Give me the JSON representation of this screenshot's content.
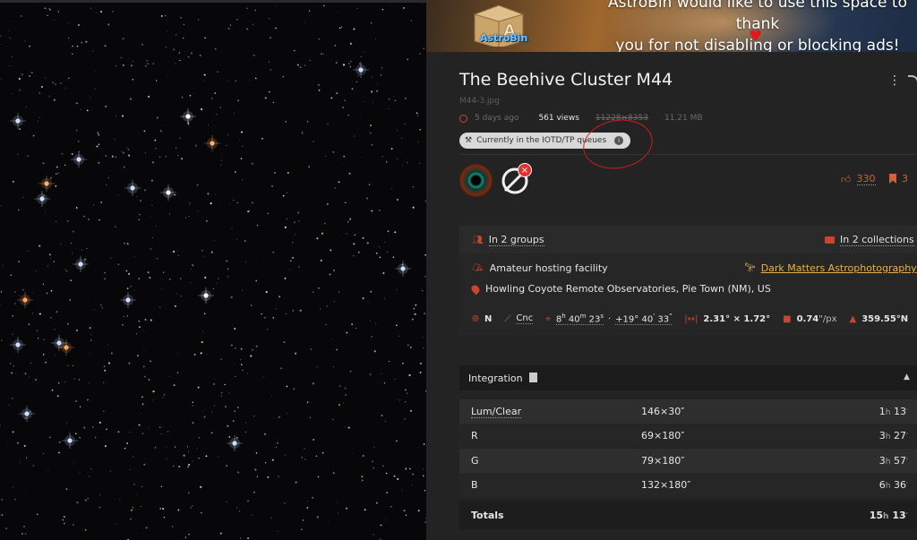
{
  "ad": {
    "line1": "AstroBin would like to use this space to thank",
    "line2": "you for not disabling or blocking ads!",
    "logo_text": "AstroBin",
    "heart": "♥"
  },
  "image": {
    "title": "The Beehive Cluster M44",
    "filename": "M44-3.jpg",
    "uploaded": "5 days ago",
    "views": "561 views",
    "resolution": "11228×8353",
    "size": "11.21 MB",
    "iotd_status": "Currently in the IOTD/TP queues"
  },
  "social": {
    "likes": "330",
    "bookmarks": "3"
  },
  "groups": {
    "groups_label": "In 2 groups",
    "collections_label": "In 2 collections"
  },
  "facility": {
    "type": "Amateur hosting facility",
    "author_link": "Dark Matters Astrophotography",
    "location": "Howling Coyote Remote Observatories, Pie Town (NM), US"
  },
  "coordinates": {
    "hemisphere": "N",
    "constellation": "Cnc",
    "ra_h": "8",
    "ra_m": "40",
    "ra_s": "23",
    "dec_d": "+19°",
    "dec_m": "40",
    "dec_s": "33",
    "fov": "2.31° × 1.72°",
    "pixscale_value": "0.74",
    "pixscale_unit": "\"/px",
    "rotation": "359.55°N"
  },
  "integration": {
    "header": "Integration",
    "rows": [
      {
        "filter": "Lum/Clear",
        "frames": "146×30″",
        "total_h": "1",
        "total_m": "13"
      },
      {
        "filter": "R",
        "frames": "69×180″",
        "total_h": "3",
        "total_m": "27"
      },
      {
        "filter": "G",
        "frames": "79×180″",
        "total_h": "3",
        "total_m": "57"
      },
      {
        "filter": "B",
        "frames": "132×180″",
        "total_h": "6",
        "total_m": "36"
      }
    ],
    "totals_label": "Totals",
    "totals_h": "15",
    "totals_m": "13"
  },
  "icons": {
    "clock": "clock-icon",
    "hammer": "hammer-icon",
    "info": "info-icon",
    "thumbs_up": "thumbs-up-icon",
    "bookmark": "bookmark-icon",
    "people": "people-icon",
    "folder": "folder-icon",
    "tent": "tent-icon",
    "map_pin": "map-pin-icon",
    "globe": "globe-icon",
    "constellation": "constellation-icon",
    "crosshair": "crosshair-icon",
    "fov": "fov-icon",
    "square": "pixel-scale-icon",
    "north": "north-arrow-icon"
  },
  "colors": {
    "accent": "#d0603f",
    "link": "#e8b04a",
    "annotation": "#d21b23",
    "panel_bg": "#232323"
  }
}
